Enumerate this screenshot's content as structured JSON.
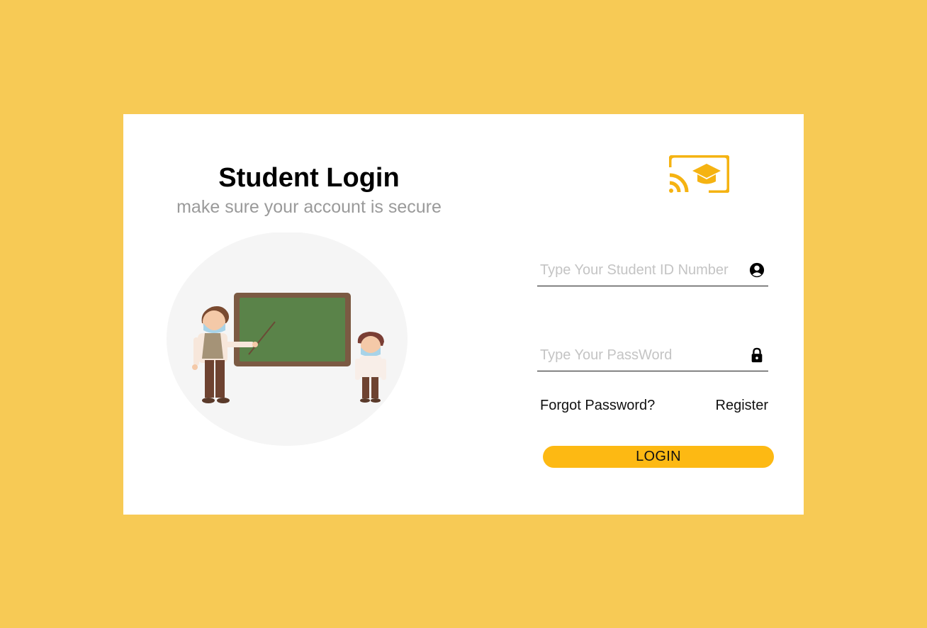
{
  "page": {
    "title": "Student Login",
    "subtitle": "make sure your account is secure"
  },
  "illustration": {
    "description_icon": "teacher-classroom-illustration"
  },
  "logo": {
    "icon": "cast-graduation-cap-icon",
    "color": "#F5B312"
  },
  "form": {
    "student_id": {
      "placeholder": "Type Your Student ID Number",
      "value": "",
      "icon": "user-circle-icon"
    },
    "password": {
      "placeholder": "Type Your PassWord",
      "value": "",
      "icon": "lock-icon"
    },
    "forgot_label": "Forgot Password?",
    "register_label": "Register",
    "login_label": "LOGIN"
  },
  "colors": {
    "background": "#F7CA55",
    "card": "#FFFFFF",
    "accent": "#FDB913",
    "subtitle": "#9A9A9A"
  }
}
